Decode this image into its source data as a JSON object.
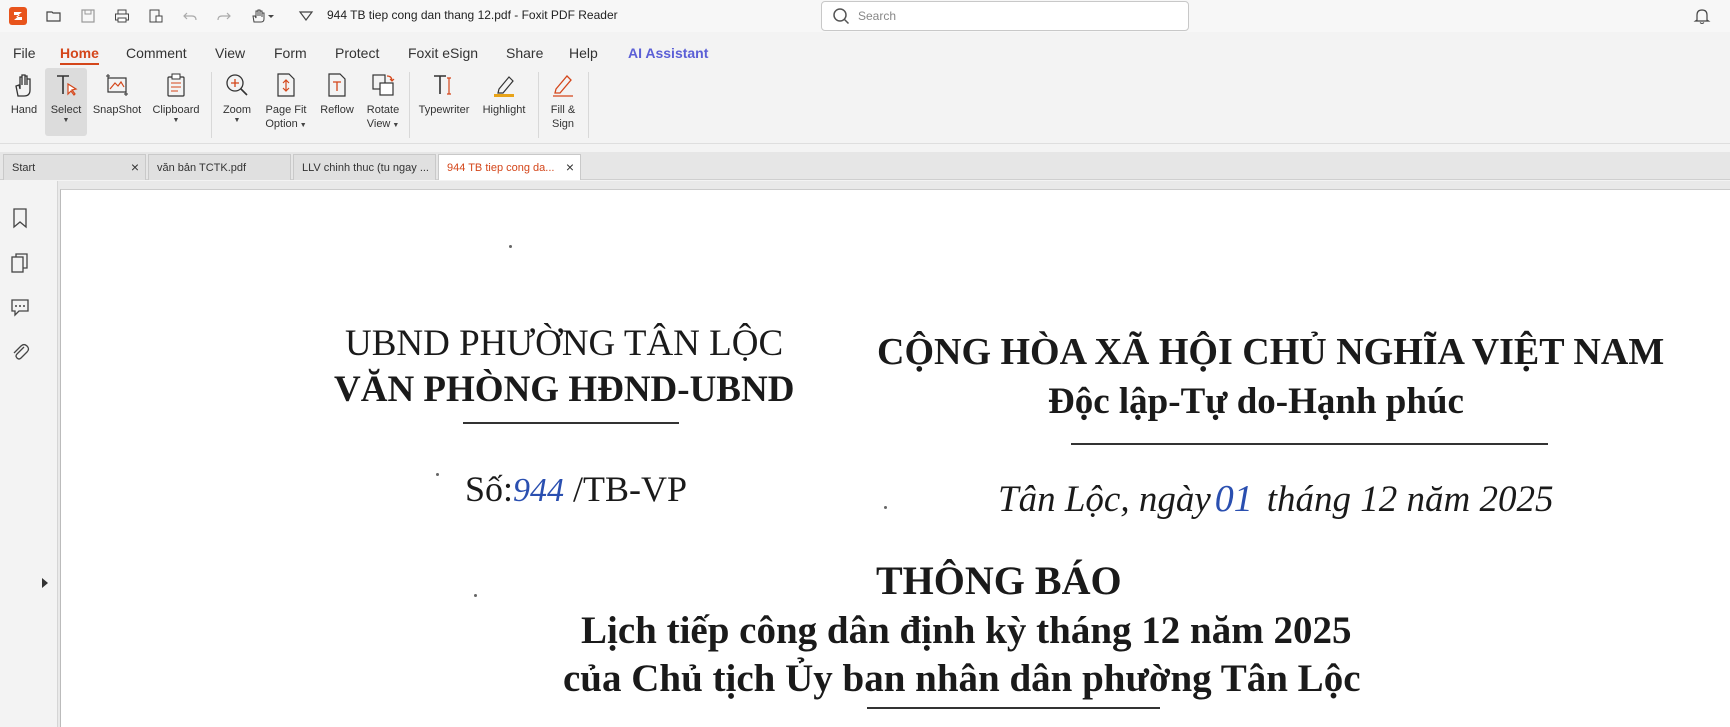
{
  "titlebar": {
    "document_title": "944 TB tiep cong dan thang 12.pdf - Foxit PDF Reader",
    "search_placeholder": "Search"
  },
  "menu": {
    "items": [
      "File",
      "Home",
      "Comment",
      "View",
      "Form",
      "Protect",
      "Foxit eSign",
      "Share",
      "Help",
      "AI Assistant"
    ],
    "active": "Home"
  },
  "ribbon": {
    "hand": "Hand",
    "select": "Select",
    "snapshot": "SnapShot",
    "clipboard": "Clipboard",
    "zoom": "Zoom",
    "page_fit_1": "Page Fit",
    "page_fit_2": "Option",
    "reflow": "Reflow",
    "rotate_1": "Rotate",
    "rotate_2": "View",
    "typewriter": "Typewriter",
    "highlight": "Highlight",
    "fill_sign_1": "Fill &",
    "fill_sign_2": "Sign"
  },
  "tabs": [
    {
      "label": "Start",
      "active": false
    },
    {
      "label": "văn bản TCTK.pdf",
      "active": false
    },
    {
      "label": "LLV chinh thuc (tu ngay ...",
      "active": false
    },
    {
      "label": "944 TB tiep cong da...",
      "active": true
    }
  ],
  "document": {
    "org_line1": "UBND PHƯỜNG TÂN LỘC",
    "org_line2": "VĂN PHÒNG HĐND-UBND",
    "nation_line1": "CỘNG HÒA XÃ HỘI CHỦ NGHĨA VIỆT NAM",
    "nation_line2": "Độc lập-Tự do-Hạnh phúc",
    "number_prefix": "Số:",
    "number_hw": "944",
    "number_suffix": "/TB-VP",
    "date_prefix": "Tân Lộc, ngày",
    "date_day_hw": "01",
    "date_suffix": "tháng 12 năm 2025",
    "heading": "THÔNG BÁO",
    "subheading1": "Lịch tiếp công dân định kỳ tháng 12 năm 2025",
    "subheading2": "của Chủ tịch Ủy ban nhân dân phường Tân Lộc"
  },
  "colors": {
    "accent": "#d4461a",
    "ai_accent": "#5b5fd6",
    "handwriting": "#2a4fb0"
  }
}
